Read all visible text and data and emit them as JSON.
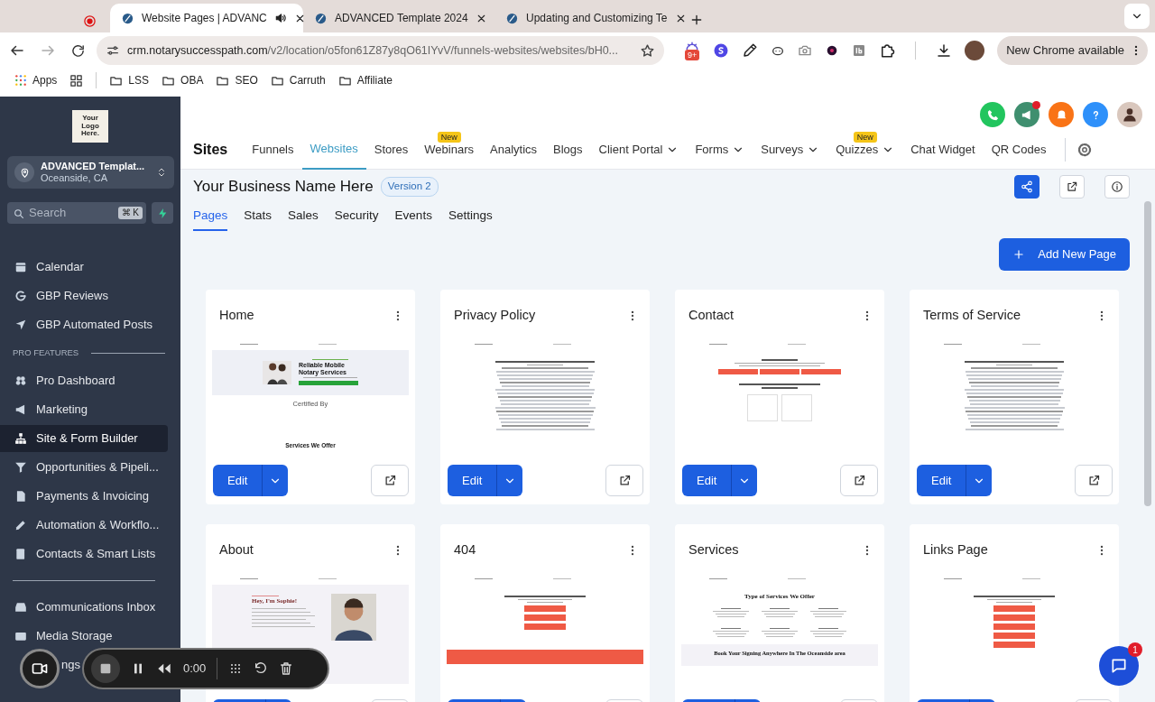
{
  "browser": {
    "tabs": [
      {
        "title": "Website Pages | ADVANC",
        "selected": true,
        "audio": true
      },
      {
        "title": "ADVANCED Template 2024",
        "selected": false,
        "audio": false
      },
      {
        "title": "Updating and Customizing Te",
        "selected": false,
        "audio": false
      }
    ],
    "can_go_forward": false,
    "url": {
      "host": "crm.notarysuccesspath.com",
      "path": "/v2/location/o5fon61Z87y8qO61IYvV/funnels-websites/websites/bH0..."
    },
    "extension_badge": "9+",
    "update_label": "New Chrome available",
    "bookmarks": [
      {
        "label": "Apps",
        "kind": "apps"
      },
      {
        "label": "LSS",
        "kind": "folder"
      },
      {
        "label": "OBA",
        "kind": "folder"
      },
      {
        "label": "SEO",
        "kind": "folder"
      },
      {
        "label": "Carruth",
        "kind": "folder"
      },
      {
        "label": "Affiliate",
        "kind": "folder"
      }
    ]
  },
  "sidebar": {
    "logo_text": "Your Logo Here.",
    "account": {
      "name": "ADVANCED Templat...",
      "location": "Oceanside, CA"
    },
    "search": {
      "placeholder": "Search",
      "shortcut": "⌘ K"
    },
    "items": [
      {
        "label": "Calendar",
        "selected": false
      },
      {
        "label": "GBP Reviews",
        "selected": false
      },
      {
        "label": "GBP Automated Posts",
        "selected": false
      }
    ],
    "section_label": "PRO FEATURES",
    "pro_items": [
      {
        "label": "Pro Dashboard",
        "selected": false
      },
      {
        "label": "Marketing",
        "selected": false
      },
      {
        "label": "Site & Form Builder",
        "selected": true
      },
      {
        "label": "Opportunities & Pipeli...",
        "selected": false
      },
      {
        "label": "Payments & Invoicing",
        "selected": false
      },
      {
        "label": "Automation & Workflo...",
        "selected": false
      },
      {
        "label": "Contacts & Smart Lists",
        "selected": false
      }
    ],
    "bottom_items": [
      {
        "label": "Communications Inbox",
        "selected": false
      },
      {
        "label": "Media Storage",
        "selected": false
      },
      {
        "label": "ngs",
        "selected": false
      }
    ]
  },
  "header": {
    "announcements_unread": true,
    "section": "Sites",
    "nav": [
      {
        "label": "Funnels",
        "selected": false,
        "dropdown": false
      },
      {
        "label": "Websites",
        "selected": true,
        "dropdown": false
      },
      {
        "label": "Stores",
        "selected": false,
        "dropdown": false
      },
      {
        "label": "Webinars",
        "selected": false,
        "dropdown": false,
        "badge": "New"
      },
      {
        "label": "Analytics",
        "selected": false,
        "dropdown": false
      },
      {
        "label": "Blogs",
        "selected": false,
        "dropdown": false
      },
      {
        "label": "Client Portal",
        "selected": false,
        "dropdown": true
      },
      {
        "label": "Forms",
        "selected": false,
        "dropdown": true
      },
      {
        "label": "Surveys",
        "selected": false,
        "dropdown": true
      },
      {
        "label": "Quizzes",
        "selected": false,
        "dropdown": true,
        "badge": "New"
      },
      {
        "label": "Chat Widget",
        "selected": false,
        "dropdown": false
      },
      {
        "label": "QR Codes",
        "selected": false,
        "dropdown": false
      }
    ]
  },
  "site": {
    "title": "Your Business Name Here",
    "version": "Version 2",
    "tabs": [
      {
        "label": "Pages",
        "selected": true
      },
      {
        "label": "Stats",
        "selected": false
      },
      {
        "label": "Sales",
        "selected": false
      },
      {
        "label": "Security",
        "selected": false
      },
      {
        "label": "Events",
        "selected": false
      },
      {
        "label": "Settings",
        "selected": false
      }
    ],
    "add_button": "Add New Page"
  },
  "pages": [
    {
      "title": "Home",
      "edit": "Edit",
      "preview": {
        "kind": "hero",
        "texts": [
          "Reliable Mobile Notary Services",
          "Certified By",
          "Services We Offer"
        ]
      }
    },
    {
      "title": "Privacy Policy",
      "edit": "Edit",
      "preview": {
        "kind": "document"
      }
    },
    {
      "title": "Contact",
      "edit": "Edit",
      "preview": {
        "kind": "form"
      }
    },
    {
      "title": "Terms of Service",
      "edit": "Edit",
      "preview": {
        "kind": "document"
      }
    },
    {
      "title": "About",
      "preview": {
        "kind": "profile",
        "texts": [
          "Hey, I'm Sophie!"
        ]
      }
    },
    {
      "title": "404",
      "preview": {
        "kind": "notfound"
      }
    },
    {
      "title": "Services",
      "preview": {
        "kind": "grid",
        "texts": [
          "Type of Services We Offer",
          "Book Your Signing Anywhere In The Oceanside area"
        ]
      }
    },
    {
      "title": "Links Page",
      "preview": {
        "kind": "links"
      }
    }
  ],
  "recorder": {
    "time": "0:00"
  },
  "chat": {
    "badge": "1"
  }
}
